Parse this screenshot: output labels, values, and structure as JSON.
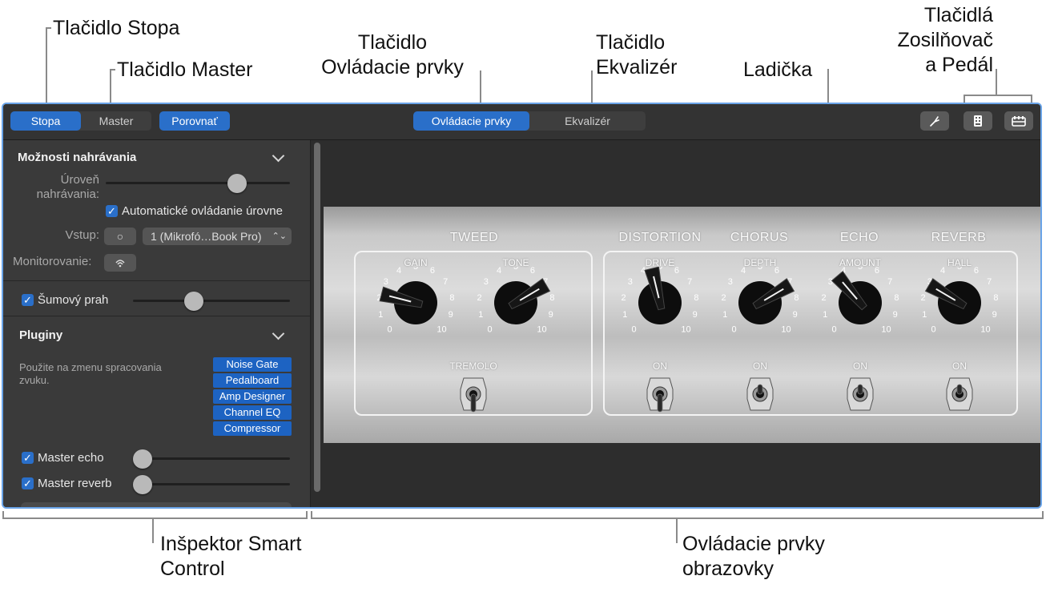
{
  "callouts": {
    "stopa_button": "Tlačidlo Stopa",
    "master_button": "Tlačidlo Master",
    "controls_button_line1": "Tlačidlo",
    "controls_button_line2": "Ovládacie prvky",
    "eq_button_line1": "Tlačidlo",
    "eq_button_line2": "Ekvalizér",
    "tuner": "Ladička",
    "amp_pedal_line1": "Tlačidlá",
    "amp_pedal_line2": "Zosilňovač",
    "amp_pedal_line3": "a Pedál",
    "inspector_line1": "Inšpektor Smart",
    "inspector_line2": "Control",
    "screen_controls_line1": "Ovládacie prvky",
    "screen_controls_line2": "obrazovky"
  },
  "toolbar": {
    "track_label": "Stopa",
    "master_label": "Master",
    "compare_label": "Porovnať",
    "controls_label": "Ovládacie prvky",
    "eq_label": "Ekvalizér",
    "tuner_icon": "tuning-fork-icon",
    "amp_icon": "amp-icon",
    "pedal_icon": "pedalboard-icon",
    "selected_view": "Stopa",
    "selected_tab": "Ovládacie prvky"
  },
  "inspector": {
    "recording_title": "Možnosti nahrávania",
    "level_label_1": "Úroveň",
    "level_label_2": "nahrávania:",
    "level_value": 0.74,
    "auto_level_label": "Automatické ovládanie úrovne",
    "auto_level_checked": true,
    "input_label": "Vstup:",
    "input_mono_symbol": "○",
    "input_value": "1 (Mikrofó…Book Pro)",
    "monitoring_label": "Monitorovanie:",
    "noise_gate_label": "Šumový prah",
    "noise_gate_checked": true,
    "noise_gate_value": 0.37,
    "plugins_title": "Pluginy",
    "plugins_desc_1": "Použite na zmenu spracovania",
    "plugins_desc_2": "zvuku.",
    "plugins": [
      "Noise Gate",
      "Pedalboard",
      "Amp Designer",
      "Channel EQ",
      "Compressor"
    ],
    "master_echo_label": "Master echo",
    "master_echo_checked": true,
    "master_echo_value": 0.0,
    "master_reverb_label": "Master reverb",
    "master_reverb_checked": true,
    "master_reverb_value": 0.0
  },
  "amp": {
    "sections": {
      "tweed": "TWEED",
      "distortion": "DISTORTION",
      "chorus": "CHORUS",
      "echo": "ECHO",
      "reverb": "REVERB"
    },
    "scale": [
      "0",
      "1",
      "2",
      "3",
      "4",
      "5",
      "6",
      "7",
      "8",
      "9",
      "10"
    ],
    "knobs": [
      {
        "id": "gain",
        "label": "GAIN",
        "value": 2.2
      },
      {
        "id": "tone",
        "label": "TONE",
        "value": 7.2
      },
      {
        "id": "drive",
        "label": "DRIVE",
        "value": 4.5
      },
      {
        "id": "depth",
        "label": "DEPTH",
        "value": 7.2
      },
      {
        "id": "amount",
        "label": "AMOUNT",
        "value": 3.5
      },
      {
        "id": "hall",
        "label": "HALL",
        "value": 2.8
      }
    ],
    "toggles": [
      {
        "id": "tremolo",
        "label": "TREMOLO",
        "on": false
      },
      {
        "id": "distortion-on",
        "label": "ON",
        "on": false
      },
      {
        "id": "chorus-on",
        "label": "ON",
        "on": true
      },
      {
        "id": "echo-on",
        "label": "ON",
        "on": true
      },
      {
        "id": "reverb-on",
        "label": "ON",
        "on": true
      }
    ]
  },
  "colors": {
    "accent": "#2a6fc9",
    "window_border": "#6aa4e8",
    "panel_bg": "#3a3a3a"
  }
}
